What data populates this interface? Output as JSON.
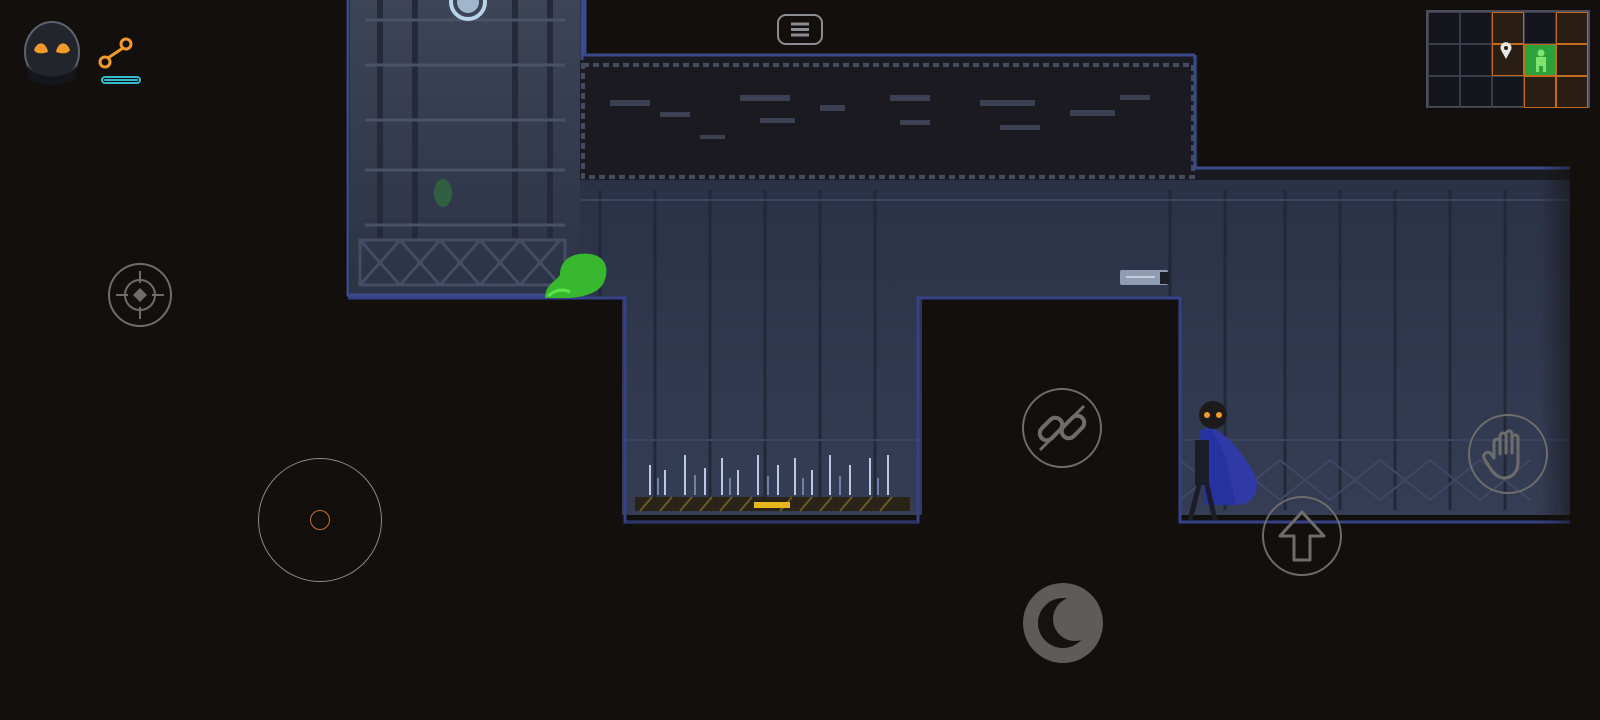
{
  "game": {
    "hud": {
      "player_icon": "masked-ninja-portrait-icon",
      "grapple_icon": "grapple-hook-icon",
      "energy_level": 1.0,
      "accent_color": "#f39a2b",
      "energy_color": "#36b9cf"
    },
    "controls": {
      "pause": "menu-icon",
      "aim": "crosshair-icon",
      "joystick": "virtual-joystick",
      "grapple": "chain-link-icon",
      "grab": "hand-icon",
      "jump": "arrow-up-icon",
      "dash": "crescent-moon-icon"
    },
    "minimap": {
      "icons": [
        "location-pin-icon",
        "player-marker-icon"
      ],
      "room_color": "#c36a1e",
      "player_color": "#2ecc40"
    },
    "world": {
      "hazard": "spike-pit",
      "enemy": "green-slime",
      "player_character": "blue-caped-ninja"
    }
  }
}
